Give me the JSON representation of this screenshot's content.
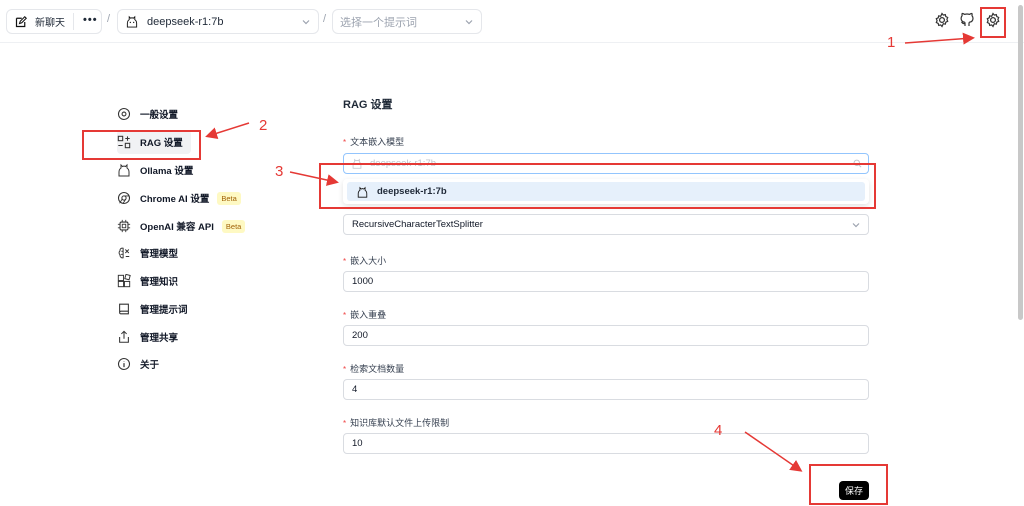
{
  "header": {
    "new_chat_label": "新聊天",
    "more_label": "•••",
    "separator": "/",
    "model_value": "deepseek-r1:7b",
    "prompt_placeholder": "选择一个提示词"
  },
  "sidebar": {
    "items": [
      {
        "label": "一般设置",
        "icon": "gear-icon"
      },
      {
        "label": "RAG 设置",
        "icon": "rag-icon"
      },
      {
        "label": "Ollama 设置",
        "icon": "ollama-icon"
      },
      {
        "label": "Chrome AI 设置",
        "icon": "chrome-icon",
        "badge": "Beta"
      },
      {
        "label": "OpenAI 兼容 API",
        "icon": "chip-icon",
        "badge": "Beta"
      },
      {
        "label": "管理模型",
        "icon": "brain-icon"
      },
      {
        "label": "管理知识",
        "icon": "blocks-icon"
      },
      {
        "label": "管理提示词",
        "icon": "book-icon"
      },
      {
        "label": "管理共享",
        "icon": "share-icon"
      },
      {
        "label": "关于",
        "icon": "info-icon"
      }
    ]
  },
  "rag": {
    "title": "RAG 设置",
    "embedding_label": "文本嵌入模型",
    "embedding_value": "deepseek-r1:7b",
    "dropdown_option": "deepseek-r1:7b",
    "splitter_value": "RecursiveCharacterTextSplitter",
    "chunk_size_label": "嵌入大小",
    "chunk_size_value": "1000",
    "chunk_overlap_label": "嵌入重叠",
    "chunk_overlap_value": "200",
    "doc_count_label": "检索文档数量",
    "doc_count_value": "4",
    "upload_limit_label": "知识库默认文件上传限制",
    "upload_limit_value": "10",
    "save_label": "保存"
  },
  "annotations": {
    "n1": "1",
    "n2": "2",
    "n3": "3",
    "n4": "4",
    "color": "#e53935"
  },
  "accent": "#000000"
}
